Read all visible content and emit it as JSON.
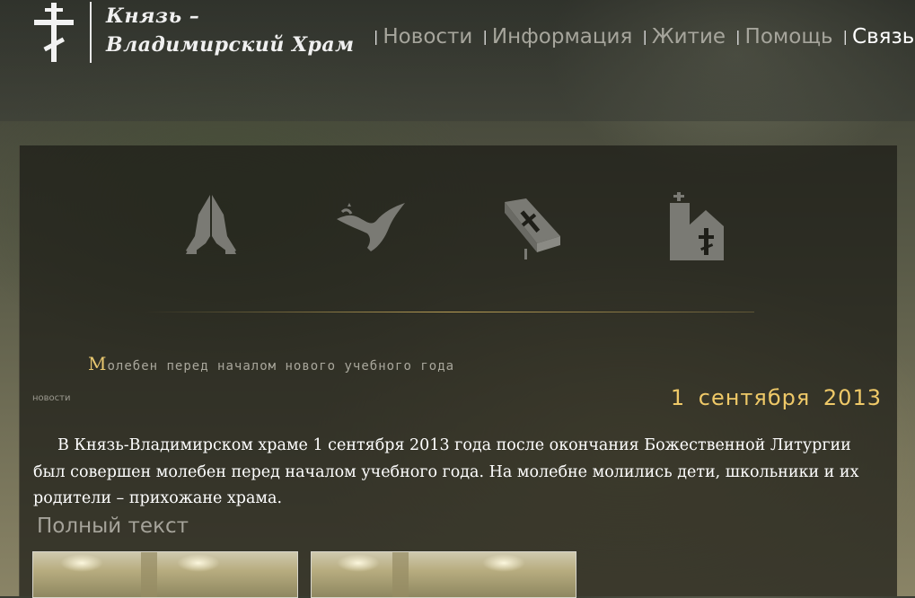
{
  "site": {
    "title_line1": "Князь –",
    "title_line2": "Владимирский Храм",
    "logo_icon": "orthodox-cross-icon"
  },
  "nav": {
    "separator": "|",
    "items": [
      {
        "label": "Новости",
        "active": false
      },
      {
        "label": "Информация",
        "active": false
      },
      {
        "label": "Житие",
        "active": false
      },
      {
        "label": "Помощь",
        "active": false
      },
      {
        "label": "Связь",
        "active": true
      }
    ]
  },
  "icons": [
    {
      "name": "praying-hands-icon"
    },
    {
      "name": "dove-icon"
    },
    {
      "name": "bible-icon"
    },
    {
      "name": "church-icon"
    }
  ],
  "article": {
    "title_initial": "М",
    "title_rest": "олебен перед началом нового учебного года",
    "category": "новости",
    "date": "1 сентября 2013",
    "body": "В Князь-Владимирском храме 1 сентября 2013 года после окончания Божественной Литургии был совершен молебен перед началом учебного года. На молебне молились дети, школьники и их родители – прихожане храма.",
    "read_more": "Полный текст"
  },
  "colors": {
    "accent_gold": "#efc968",
    "nav_text": "#a6a59c",
    "nav_active": "#ffffff",
    "panel_bg": "#1c1c16"
  }
}
